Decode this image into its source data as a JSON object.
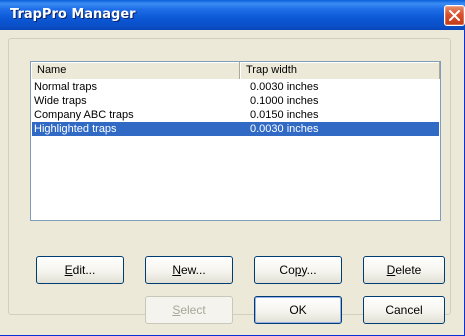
{
  "window": {
    "title": "TrapPro Manager",
    "close_glyph": "✕",
    "close_icon": "close-icon"
  },
  "list": {
    "columns": [
      "Name",
      "Trap width"
    ],
    "rows": [
      {
        "name": "Normal traps",
        "width": "0.0030 inches",
        "selected": false
      },
      {
        "name": "Wide traps",
        "width": "0.1000 inches",
        "selected": false
      },
      {
        "name": "Company ABC traps",
        "width": "0.0150 inches",
        "selected": false
      },
      {
        "name": "Highlighted traps",
        "width": "0.0030 inches",
        "selected": true
      }
    ]
  },
  "buttons": {
    "edit": {
      "mnemonic": "E",
      "rest": "dit..."
    },
    "new": {
      "mnemonic": "N",
      "rest": "ew..."
    },
    "copy": {
      "pre": "Co",
      "mnemonic": "p",
      "rest": "y..."
    },
    "delete": {
      "mnemonic": "D",
      "rest": "elete"
    },
    "select": {
      "mnemonic": "S",
      "rest": "elect",
      "enabled": false
    },
    "ok": {
      "label": "OK"
    },
    "cancel": {
      "label": "Cancel"
    }
  },
  "colors": {
    "titlebar": "#0a5fd8",
    "selection": "#316ac5",
    "close": "#d8502e",
    "dialog_bg": "#ece9d8"
  }
}
